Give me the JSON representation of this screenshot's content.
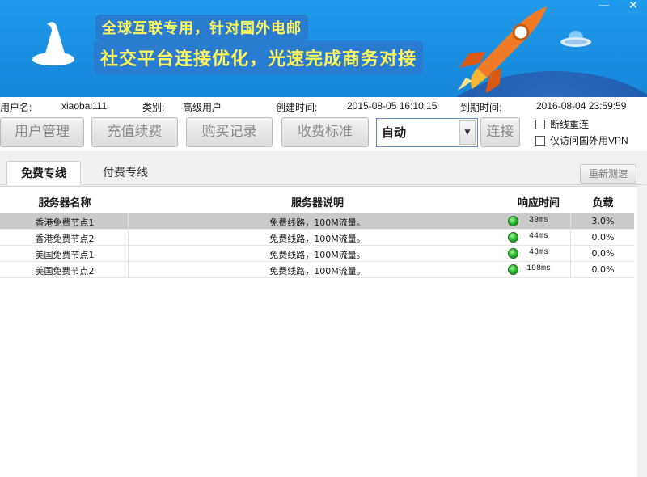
{
  "banner": {
    "slogan_line1": "全球互联专用，针对国外电邮",
    "slogan_line2": "社交平台连接优化，光速完成商务对接",
    "minimize_glyph": "—",
    "close_glyph": "✕"
  },
  "account": {
    "username_label": "用户名:",
    "username": "xiaobai111",
    "type_label": "类别:",
    "type": "高级用户",
    "created_label": "创建时间:",
    "created": "2015-08-05 16:10:15",
    "expire_label": "到期时间:",
    "expire": "2016-08-04 23:59:59"
  },
  "toolbar": {
    "user_manage": "用户管理",
    "recharge": "充值续费",
    "purchase_record": "购买记录",
    "pricing": "收费标准",
    "mode_value": "自动",
    "connect": "连接",
    "auto_reconnect": "断线重连",
    "foreign_only": "仅访问国外用VPN"
  },
  "tabs": {
    "free": "免费专线",
    "paid": "付费专线",
    "retest": "重新测速"
  },
  "table": {
    "headers": {
      "name": "服务器名称",
      "desc": "服务器说明",
      "latency": "响应时间",
      "load": "负载"
    },
    "rows": [
      {
        "name": "香港免费节点1",
        "desc": "免费线路，100M流量。",
        "latency": "39ms",
        "load": "3.0%"
      },
      {
        "name": "香港免费节点2",
        "desc": "免费线路，100M流量。",
        "latency": "44ms",
        "load": "0.0%"
      },
      {
        "name": "美国免费节点1",
        "desc": "免费线路，100M流量。",
        "latency": "43ms",
        "load": "0.0%"
      },
      {
        "name": "美国免费节点2",
        "desc": "免费线路，100M流量。",
        "latency": "198ms",
        "load": "0.0%"
      }
    ]
  },
  "colors": {
    "banner_blue": "#1a8ee0",
    "slogan_yellow": "#fff65b",
    "status_green": "#28b428",
    "selected_row": "#cacaca"
  }
}
